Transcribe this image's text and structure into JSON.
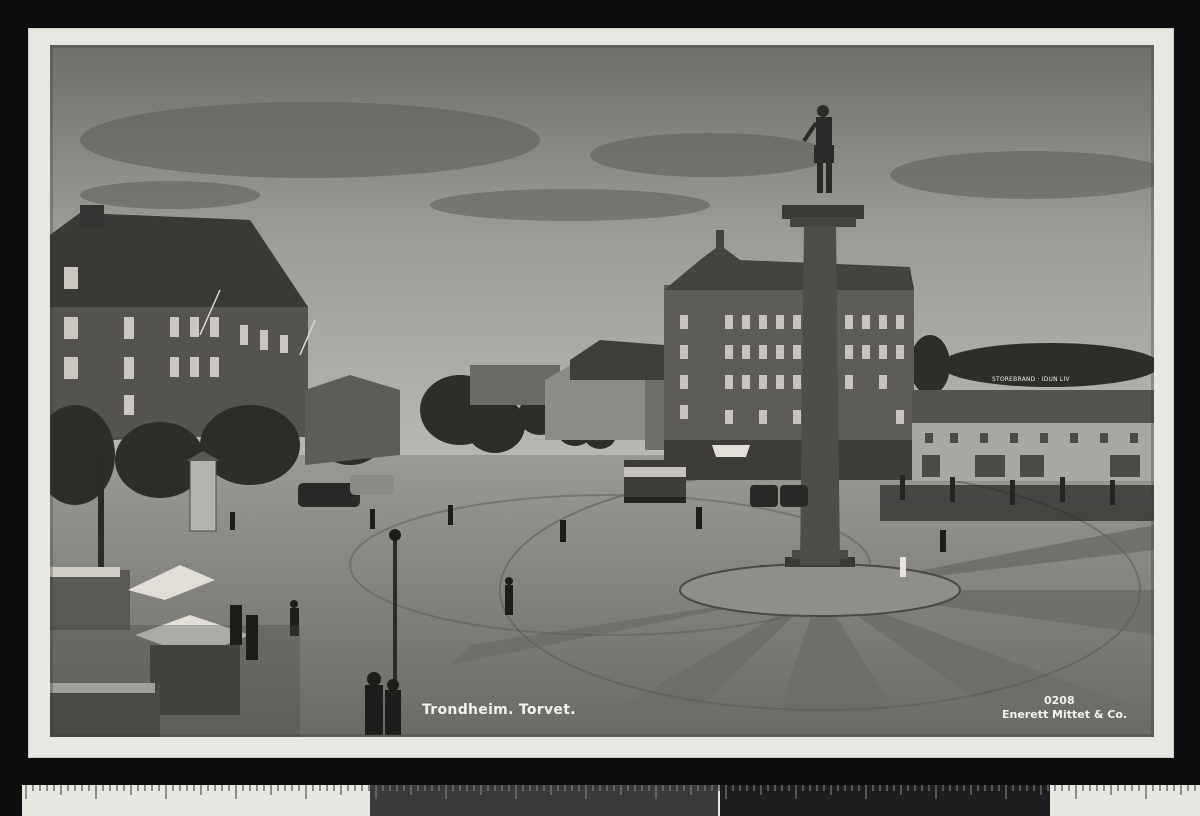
{
  "postcard": {
    "caption": "Trondheim. Torvet.",
    "photo_number": "0208",
    "publisher": "Enerett Mittet & Co.",
    "shop_sign": "STOREBRAND · IDUN LIV"
  },
  "colors": {
    "background": "#0d0d0d",
    "card_border": "#e9e7e1",
    "sky": "#a9a8a3",
    "pavement": "#7a7975"
  },
  "ruler": {
    "segments": [
      "light",
      "dark",
      "light",
      "dark",
      "light"
    ]
  }
}
